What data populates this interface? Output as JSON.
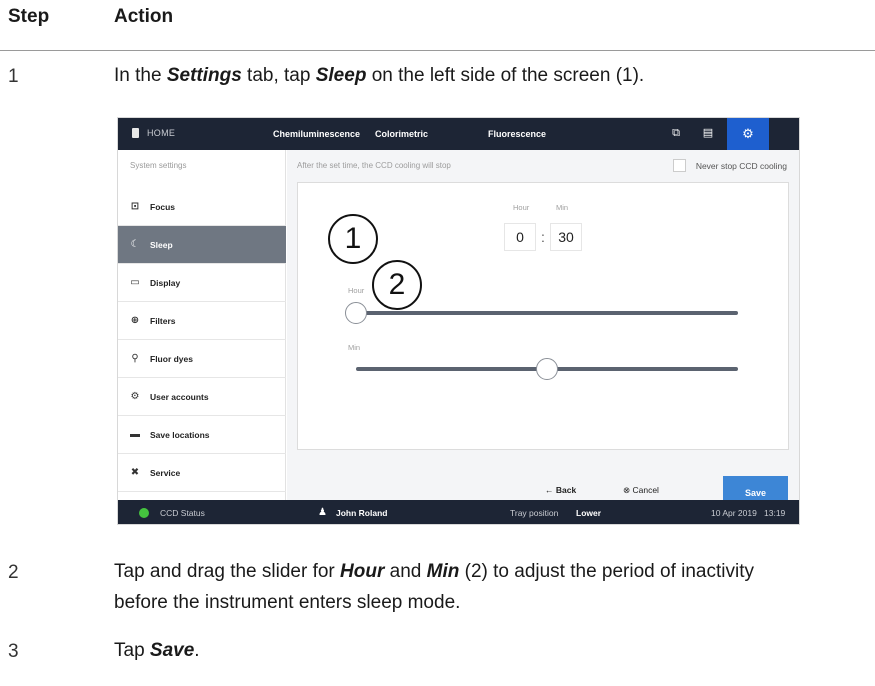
{
  "table_header": {
    "step": "Step",
    "action": "Action"
  },
  "steps": [
    {
      "number": "1",
      "parts": [
        "In the ",
        "Settings",
        " tab, tap ",
        "Sleep",
        " on the left side of the screen (1)."
      ]
    },
    {
      "number": "2",
      "parts": [
        "Tap and drag the slider for ",
        "Hour",
        " and ",
        "Min",
        " (2) to adjust the period of inactivity",
        "before the instrument enters sleep mode."
      ]
    },
    {
      "number": "3",
      "parts": [
        "Tap ",
        "Save",
        "."
      ]
    }
  ],
  "screenshot": {
    "top_bar": {
      "home_label": "HOME",
      "tabs": [
        "Chemiluminescence",
        "Colorimetric",
        "Fluorescence"
      ],
      "icons": [
        "gallery-icon",
        "storage-icon",
        "gear-icon"
      ]
    },
    "sidebar": {
      "title": "System settings",
      "items": [
        {
          "label": "Focus",
          "icon": "focus-icon",
          "glyph": "⊡"
        },
        {
          "label": "Sleep",
          "icon": "moon-icon",
          "glyph": "☾"
        },
        {
          "label": "Display",
          "icon": "monitor-icon",
          "glyph": "▭"
        },
        {
          "label": "Filters",
          "icon": "filter-icon",
          "glyph": "⊕"
        },
        {
          "label": "Fluor dyes",
          "icon": "dye-icon",
          "glyph": "⚲"
        },
        {
          "label": "User accounts",
          "icon": "user-accounts-icon",
          "glyph": "⚙"
        },
        {
          "label": "Save locations",
          "icon": "folder-icon",
          "glyph": "▬"
        },
        {
          "label": "Service",
          "icon": "tools-icon",
          "glyph": "✖"
        }
      ],
      "active_item": "Sleep"
    },
    "main": {
      "hint": "After the set time, the CCD cooling will stop",
      "never_stop_label": "Never stop CCD cooling",
      "never_stop_checked": false,
      "time": {
        "hour_label": "Hour",
        "min_label": "Min",
        "hour_value": "0",
        "min_value": "30",
        "separator": ":"
      },
      "sliders": [
        {
          "label": "Hour",
          "value": 0,
          "max": 24,
          "fraction": 0.0
        },
        {
          "label": "Min",
          "value": 30,
          "max": 60,
          "fraction": 0.5
        }
      ]
    },
    "footer": {
      "back_label": "← Back",
      "cancel_label": "⊗ Cancel",
      "save_label": "Save"
    },
    "status_bar": {
      "ccd_status_label": "CCD Status",
      "ccd_status_color": "#45c43f",
      "user_name": "John Roland",
      "tray_label": "Tray position",
      "tray_value": "Lower",
      "date": "10 Apr 2019",
      "time": "13:19"
    },
    "callouts": [
      "1",
      "2"
    ]
  }
}
